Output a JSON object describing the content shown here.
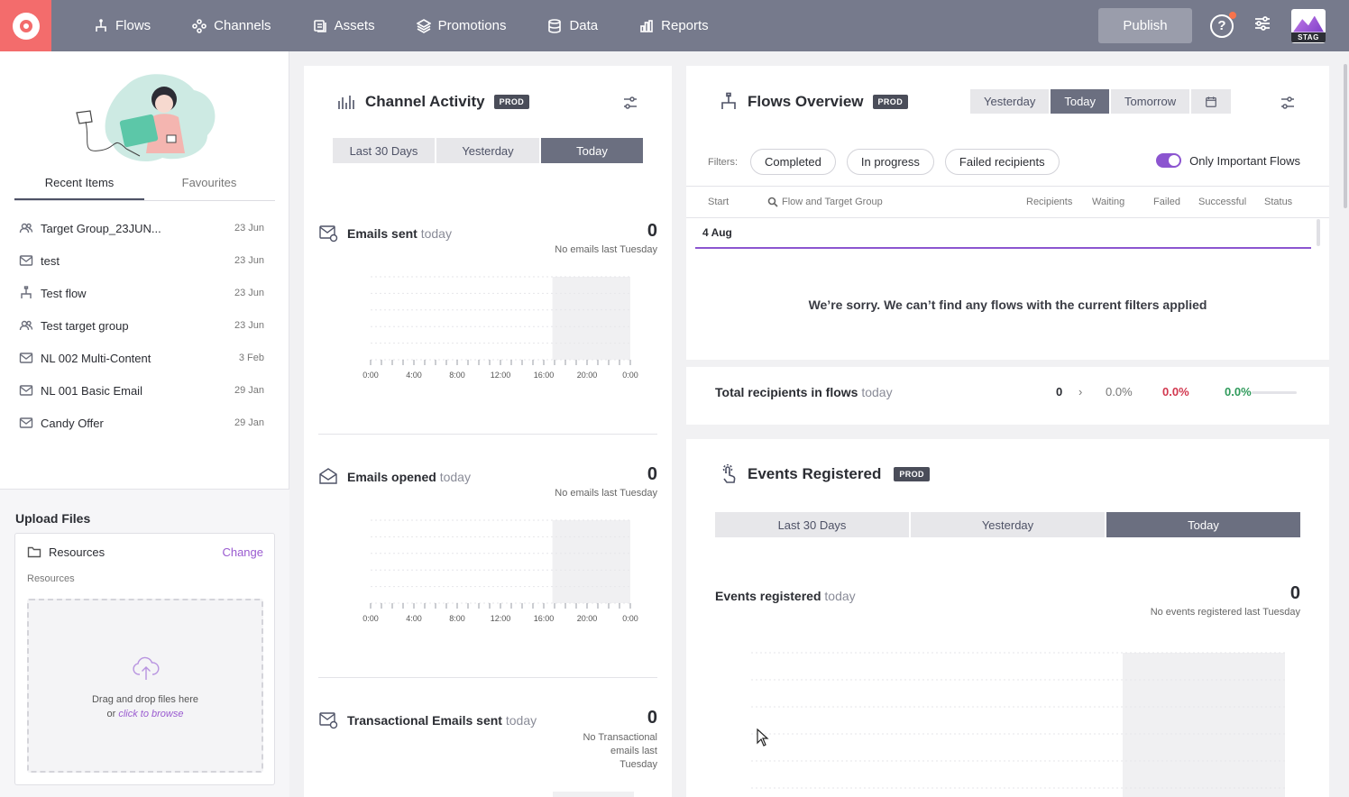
{
  "nav": {
    "items": [
      {
        "label": "Flows",
        "icon": "flows-icon"
      },
      {
        "label": "Channels",
        "icon": "channels-icon"
      },
      {
        "label": "Assets",
        "icon": "assets-icon"
      },
      {
        "label": "Promotions",
        "icon": "promotions-icon"
      },
      {
        "label": "Data",
        "icon": "data-icon"
      },
      {
        "label": "Reports",
        "icon": "reports-icon"
      }
    ],
    "publish_label": "Publish",
    "help_label": "?",
    "env_label": "STAG"
  },
  "sidebar": {
    "tabs": [
      "Recent Items",
      "Favourites"
    ],
    "recent": [
      {
        "name": "Target Group_23JUN...",
        "date": "23 Jun",
        "icon": "target-group-icon"
      },
      {
        "name": "test",
        "date": "23 Jun",
        "icon": "email-icon"
      },
      {
        "name": "Test flow",
        "date": "23 Jun",
        "icon": "flow-icon"
      },
      {
        "name": "Test target group",
        "date": "23 Jun",
        "icon": "target-group-icon"
      },
      {
        "name": "NL 002 Multi-Content",
        "date": "3 Feb",
        "icon": "email-icon"
      },
      {
        "name": "NL 001 Basic Email",
        "date": "29 Jan",
        "icon": "email-icon"
      },
      {
        "name": "Candy Offer",
        "date": "29 Jan",
        "icon": "email-icon"
      }
    ],
    "upload": {
      "title": "Upload Files",
      "folder": "Resources",
      "change": "Change",
      "path": "Resources",
      "drop_line1": "Drag and drop files here",
      "drop_or": "or ",
      "drop_link": "click to browse"
    }
  },
  "channel_activity": {
    "title": "Channel Activity",
    "badge": "PROD",
    "ranges": [
      "Last 30 Days",
      "Yesterday",
      "Today"
    ],
    "active_range": "Today",
    "metrics": [
      {
        "name": "Emails sent",
        "suffix": "today",
        "value": "0",
        "sub": "No emails last Tuesday"
      },
      {
        "name": "Emails opened",
        "suffix": "today",
        "value": "0",
        "sub": "No emails last Tuesday"
      },
      {
        "name": "Transactional Emails sent",
        "suffix": "today",
        "value": "0",
        "sub": "No Transactional emails last Tuesday"
      }
    ],
    "x_ticks": [
      "0:00",
      "4:00",
      "8:00",
      "12:00",
      "16:00",
      "20:00",
      "0:00"
    ]
  },
  "flows_overview": {
    "title": "Flows Overview",
    "badge": "PROD",
    "days": [
      "Yesterday",
      "Today",
      "Tomorrow"
    ],
    "active_day": "Today",
    "filters_label": "Filters:",
    "filters": [
      "Completed",
      "In progress",
      "Failed recipients"
    ],
    "toggle_label": "Only Important Flows",
    "toggle_on": true,
    "columns": {
      "start": "Start",
      "search": "Flow and Target Group",
      "recipients": "Recipients",
      "waiting": "Waiting",
      "failed": "Failed",
      "successful": "Successful",
      "status": "Status"
    },
    "date_group": "4 Aug",
    "empty_message": "We’re sorry. We can’t find any flows with the current filters applied",
    "total": {
      "label": "Total recipients in flows",
      "suffix": "today",
      "count": "0",
      "arrow": "›",
      "waiting_pct": "0.0%",
      "failed_pct": "0.0%",
      "success_pct": "0.0%"
    }
  },
  "events_registered": {
    "title": "Events Registered",
    "badge": "PROD",
    "ranges": [
      "Last 30 Days",
      "Yesterday",
      "Today"
    ],
    "active_range": "Today",
    "metric": {
      "name": "Events registered",
      "suffix": "today",
      "value": "0",
      "sub": "No events registered last Tuesday"
    }
  },
  "colors": {
    "topbar": "#767a8c",
    "logo": "#f36c6c",
    "accent": "#8c55d0",
    "failed": "#d2384f",
    "success": "#2f9a5b"
  }
}
